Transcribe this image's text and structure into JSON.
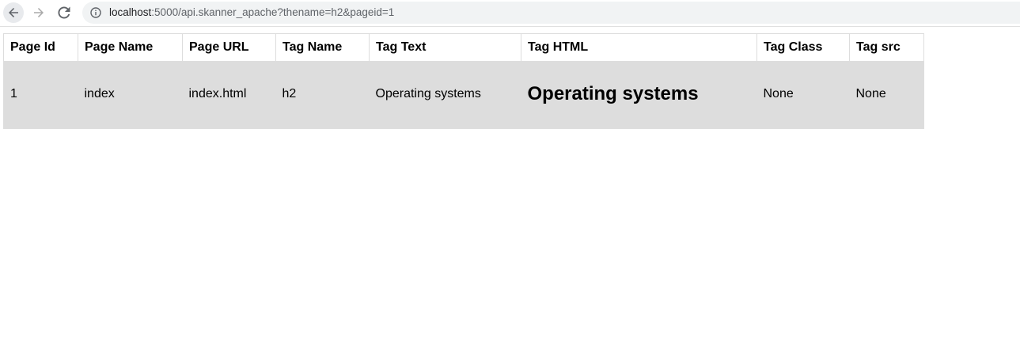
{
  "browser": {
    "url_host": "localhost",
    "url_path": ":5000/api.skanner_apache?thename=h2&pageid=1"
  },
  "table": {
    "columns": [
      "Page Id",
      "Page Name",
      "Page URL",
      "Tag Name",
      "Tag Text",
      "Tag HTML",
      "Tag Class",
      "Tag src"
    ],
    "rows": [
      [
        "1",
        "index",
        "index.html",
        "h2",
        "Operating systems",
        "Operating systems",
        "None",
        "None"
      ]
    ]
  },
  "colors": {
    "row_background": "#dddddd",
    "omnibox_background": "#f1f3f4"
  }
}
